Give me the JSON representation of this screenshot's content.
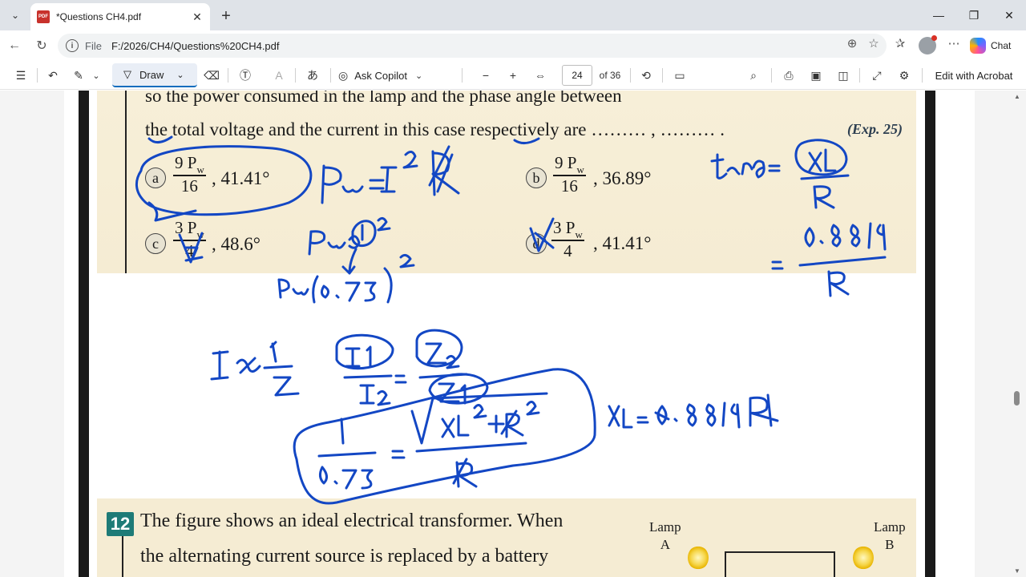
{
  "browser": {
    "tab_title": "*Questions CH4.pdf",
    "new_tab_symbol": "+",
    "close_symbol": "✕",
    "address_label": "File",
    "address": "F:/2026/CH4/Questions%20CH4.pdf",
    "copilot_label": "Chat",
    "window": {
      "minimize": "—",
      "restore": "❐",
      "close": "✕"
    }
  },
  "pdf_toolbar": {
    "draw_label": "Draw",
    "ask_copilot_label": "Ask Copilot",
    "zoom_out": "−",
    "zoom_in": "+",
    "page_current": "24",
    "page_total": "of 36",
    "edit_acrobat_label": "Edit with Acrobat"
  },
  "document": {
    "line1": "so the power consumed in the lamp and the phase angle between",
    "line2": "the total voltage and  the current in this case respectively are ……… , ……… .",
    "exp_ref": "(Exp. 25)",
    "options": [
      {
        "letter": "a",
        "num": "9 P",
        "sub": "w",
        "den": "16",
        "tail": ", 41.41°"
      },
      {
        "letter": "b",
        "num": "9 P",
        "sub": "w",
        "den": "16",
        "tail": ", 36.89°"
      },
      {
        "letter": "c",
        "num": "3 P",
        "sub": "w",
        "den": "4",
        "tail": ", 48.6°"
      },
      {
        "letter": "d",
        "num": "3 P",
        "sub": "w",
        "den": "4",
        "tail": ", 41.41°"
      }
    ],
    "q12_number": "12",
    "q12_line1": "The figure shows an ideal electrical transformer. When",
    "q12_line2": "the alternating current source is replaced by a battery",
    "lamp_a": "Lamp\nA",
    "lamp_b": "Lamp\nB"
  },
  "accent": {
    "ink_blue": "#1347c4",
    "question_teal": "#1e7b77",
    "draw_underline": "#0f6cbd"
  },
  "icons": [
    "tab-actions-icon",
    "pdf-file-icon",
    "back-icon",
    "refresh-icon",
    "info-icon",
    "zoom-icon",
    "favorite-icon",
    "collections-icon",
    "profile-avatar",
    "more-icon",
    "copilot-icon",
    "contents-icon",
    "undo-icon",
    "highlight-icon",
    "draw-icon",
    "eraser-icon",
    "text-box-icon",
    "read-aloud-icon",
    "translate-icon",
    "copilot-ask-icon",
    "fit-width-icon",
    "rotate-icon",
    "page-view-icon",
    "search-icon",
    "print-icon",
    "save-icon",
    "save-as-icon",
    "fullscreen-icon",
    "settings-icon"
  ]
}
